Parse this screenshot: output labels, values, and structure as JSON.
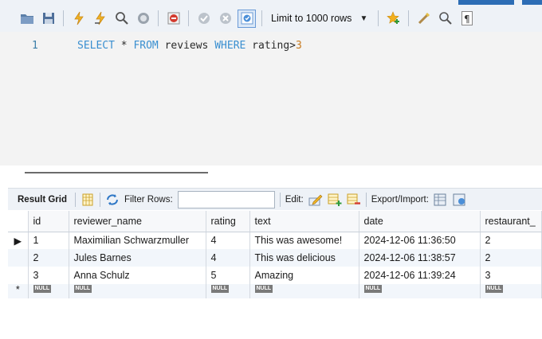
{
  "toolbar": {
    "limit_label": "Limit to 1000 rows"
  },
  "editor": {
    "line_number": "1",
    "query": {
      "kw_select": "SELECT",
      "star": " * ",
      "kw_from": "FROM",
      "table": " reviews ",
      "kw_where": "WHERE",
      "condition": " rating>",
      "value": "3"
    }
  },
  "result_toolbar": {
    "tab_label": "Result Grid",
    "filter_label": "Filter Rows:",
    "filter_value": "",
    "edit_label": "Edit:",
    "export_label": "Export/Import:"
  },
  "grid": {
    "columns": [
      "id",
      "reviewer_name",
      "rating",
      "text",
      "date",
      "restaurant_"
    ],
    "rows": [
      [
        "1",
        "Maximilian Schwarzmuller",
        "4",
        "This was awesome!",
        "2024-12-06 11:36:50",
        "2"
      ],
      [
        "2",
        "Jules Barnes",
        "4",
        "This was delicious",
        "2024-12-06 11:38:57",
        "2"
      ],
      [
        "3",
        "Anna Schulz",
        "5",
        "Amazing",
        "2024-12-06 11:39:24",
        "3"
      ]
    ],
    "null_label": "NULL",
    "current_row_marker": "▶",
    "new_row_marker": "*"
  },
  "colors": {
    "keyword": "#3a8fd0",
    "number": "#c87a1e",
    "line_number": "#3b7ea8",
    "toolbar_bg": "#eef2f7"
  }
}
